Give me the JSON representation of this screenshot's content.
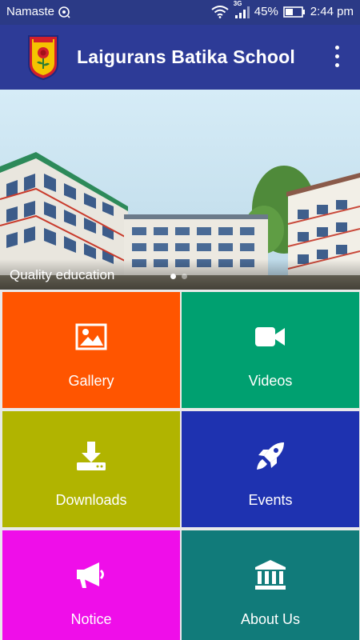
{
  "status_bar": {
    "carrier": "Namaste",
    "network": "3G",
    "battery": "45%",
    "time": "2:44 pm"
  },
  "app_bar": {
    "title": "Laigurans Batika School",
    "menu_icon": "more-vert-icon",
    "logo": "school-crest-logo"
  },
  "banner": {
    "caption": "Quality education",
    "slides_total": 2,
    "active_slide": 1
  },
  "tiles": [
    {
      "label": "Gallery",
      "icon": "image-icon",
      "color": "#ff5500"
    },
    {
      "label": "Videos",
      "icon": "video-icon",
      "color": "#00a070"
    },
    {
      "label": "Downloads",
      "icon": "download-icon",
      "color": "#b1b400"
    },
    {
      "label": "Events",
      "icon": "rocket-icon",
      "color": "#1e32b0"
    },
    {
      "label": "Notice",
      "icon": "megaphone-icon",
      "color": "#ef0ee9"
    },
    {
      "label": "About Us",
      "icon": "bank-icon",
      "color": "#117b7a"
    }
  ],
  "colors": {
    "status_bar": "#2b3a86",
    "app_bar": "#2d3b97"
  }
}
